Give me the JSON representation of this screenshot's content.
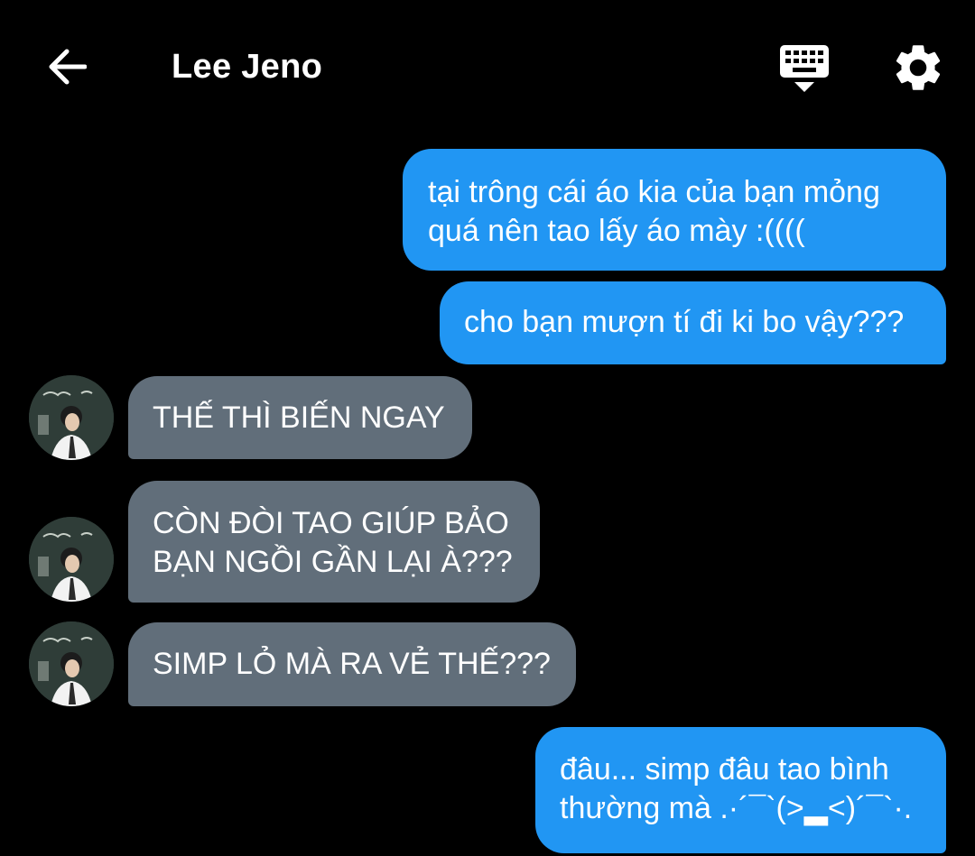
{
  "header": {
    "title": "Lee Jeno",
    "back_icon": "arrow-left-icon",
    "keyboard_icon": "keyboard-hide-icon",
    "settings_icon": "gear-icon"
  },
  "colors": {
    "background": "#000000",
    "sent_bubble": "#2196f3",
    "received_bubble": "#616e7a",
    "text": "#ffffff"
  },
  "messages": [
    {
      "side": "sent",
      "lines": [
        "tại trông cái áo kia của bạn mỏng",
        "quá nên tao lấy áo mày :(((("
      ]
    },
    {
      "side": "sent",
      "lines": [
        "cho bạn mượn tí đi ki bo vậy???"
      ]
    },
    {
      "side": "received",
      "lines": [
        "THẾ THÌ BIẾN NGAY"
      ]
    },
    {
      "side": "received",
      "lines": [
        "CÒN ĐÒI TAO GIÚP BẢO",
        "BẠN NGỒI GẦN LẠI À???"
      ]
    },
    {
      "side": "received",
      "lines": [
        "SIMP LỎ MÀ RA VẺ THẾ???"
      ]
    },
    {
      "side": "sent",
      "lines": [
        "đâu... simp đâu tao bình",
        "thường mà .·´¯`(>▂<)´¯`·."
      ]
    }
  ]
}
